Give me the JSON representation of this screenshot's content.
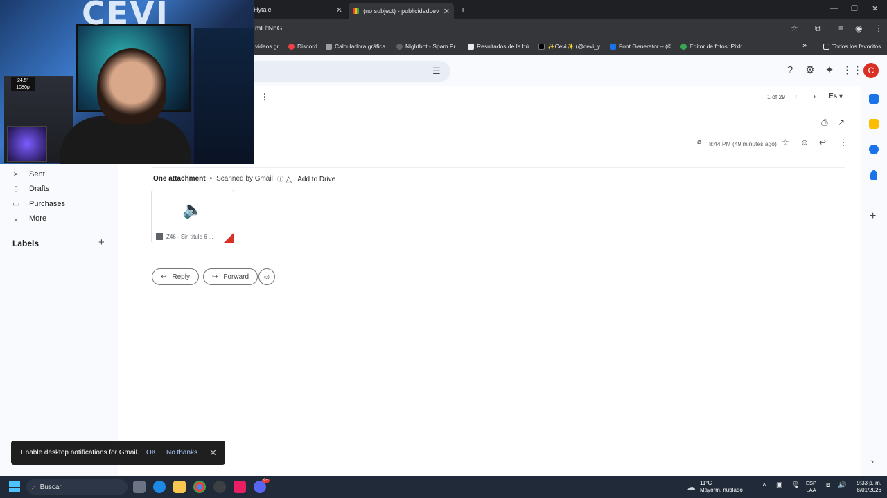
{
  "browser": {
    "tabs": [
      {
        "label": "Hytale",
        "active": false
      },
      {
        "label": "(no subject) - publicidadcevi@",
        "active": false
      }
    ],
    "url": "mLltNnG",
    "bookmarks": [
      {
        "label": "videos gr...",
        "color": "#9aa0a6"
      },
      {
        "label": "Discord",
        "color": "#ed4245"
      },
      {
        "label": "Calculadora gráfica...",
        "color": "#9aa0a6"
      },
      {
        "label": "Nightbot - Spam Pr...",
        "color": "#5f6368"
      },
      {
        "label": "Resultados de la bú...",
        "color": "#e8eaed"
      },
      {
        "label": "✨Cevi✨ (@cevi_y...",
        "color": "#000000"
      },
      {
        "label": "Font Generator – (©...",
        "color": "#1a73e8"
      },
      {
        "label": "Editor de fotos: Pixlr...",
        "color": "#34a853"
      }
    ],
    "all_bookmarks_label": "Todos los favoritos"
  },
  "gmail": {
    "avatar_letter": "C",
    "nav": {
      "items": [
        {
          "label": "Sent",
          "icon": "send-icon"
        },
        {
          "label": "Drafts",
          "icon": "draft-icon"
        },
        {
          "label": "Purchases",
          "icon": "purchases-icon"
        },
        {
          "label": "More",
          "icon": "chevron-down-icon"
        }
      ],
      "labels_header": "Labels"
    },
    "toolbar": {
      "page_count": "1 of 29",
      "language": "Es"
    },
    "message": {
      "timestamp": "8:44 PM (49 minutes ago)",
      "attachment_summary": "One attachment",
      "scanned_text": "Scanned by Gmail",
      "add_to_drive": "Add to Drive",
      "attachment_name": "Z46 - Sin título 6 ..."
    },
    "actions": {
      "reply": "Reply",
      "forward": "Forward"
    },
    "toast": {
      "message": "Enable desktop notifications for Gmail.",
      "ok": "OK",
      "no_thanks": "No thanks"
    }
  },
  "webcam": {
    "logo_text": "CEVI",
    "box_text": "24.5\" 1080p"
  },
  "taskbar": {
    "search_placeholder": "Buscar",
    "weather_temp": "11°C",
    "weather_desc": "Mayorm. nublado",
    "lang_line1": "ESP",
    "lang_line2": "LAA",
    "time": "9:33 p. m.",
    "date": "8/01/2026",
    "discord_badge": "9+"
  },
  "colors": {
    "accent_blue": "#0b57d0",
    "toast_link": "#a8c7fa",
    "avatar_red": "#d93025"
  }
}
